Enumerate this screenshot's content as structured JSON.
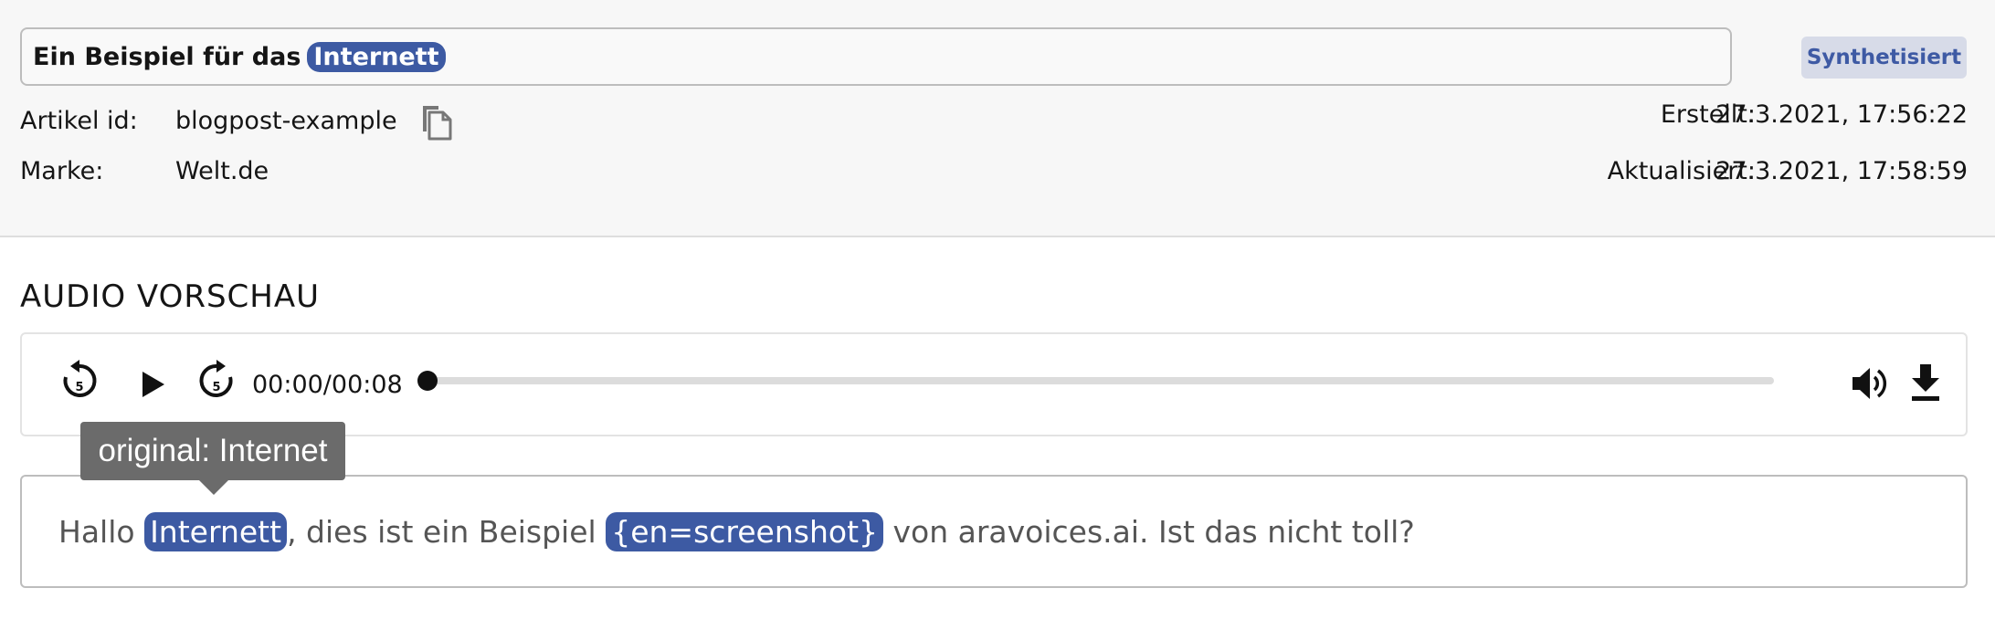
{
  "article": {
    "title_text": "Ein Beispiel für das",
    "title_highlight": "Internett",
    "status": "Synthetisiert",
    "id_label": "Artikel id:",
    "id_value": "blogpost-example",
    "brand_label": "Marke:",
    "brand_value": "Welt.de",
    "created_label": "Erstellt:",
    "created_value": "27.3.2021, 17:56:22",
    "updated_label": "Aktualisiert:",
    "updated_value": "27.3.2021, 17:58:59"
  },
  "audio": {
    "section_title": "AUDIO VORSCHAU",
    "time": "00:00/00:08",
    "progress": 0,
    "icons": [
      "replay-5-icon",
      "play-icon",
      "forward-5-icon",
      "volume-icon",
      "download-icon"
    ]
  },
  "tooltip": {
    "text": "original: Internet"
  },
  "content": {
    "part1": "Hallo",
    "hl1": "Internett",
    "part2": ", dies ist ein Beispiel",
    "hl2": "{en=screenshot}",
    "part3": "von aravoices.ai. Ist das nicht toll?"
  },
  "colors": {
    "highlight": "#3d5aa3",
    "badge_bg": "#d7dbe8",
    "badge_text": "#3e5aa4",
    "tooltip_bg": "#6b6b6b"
  }
}
